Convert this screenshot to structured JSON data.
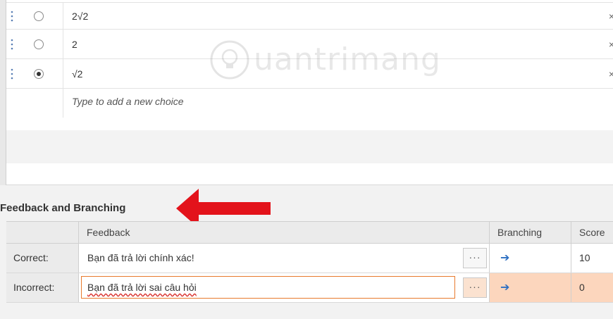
{
  "choices": [
    {
      "text": "2√2",
      "selected": false,
      "remove": "×"
    },
    {
      "text": "2",
      "selected": false,
      "remove": "×"
    },
    {
      "text": "√2",
      "selected": true,
      "remove": "×"
    }
  ],
  "add_choice": {
    "placeholder": "Type to add a new choice"
  },
  "watermark": {
    "text": "uantrimang"
  },
  "feedback": {
    "title": "Feedback and Branching",
    "headers": {
      "feedback": "Feedback",
      "branching": "Branching",
      "score": "Score"
    },
    "rows": [
      {
        "label": "Correct:",
        "text": "Bạn đã trả lời chính xác!",
        "more": "···",
        "branch_icon": "arrow-right-icon",
        "branch": "➔",
        "score": "10"
      },
      {
        "label": "Incorrect:",
        "text": "Bạn đã trả lời sai câu hỏi",
        "more": "···",
        "branch_icon": "arrow-right-icon",
        "branch": "➔",
        "score": "0"
      }
    ]
  },
  "colors": {
    "accent_orange": "#e87a2d",
    "selected_row": "#fcd6bd",
    "branch_arrow": "#2d6fc2",
    "annotation_arrow": "#e3131b"
  }
}
